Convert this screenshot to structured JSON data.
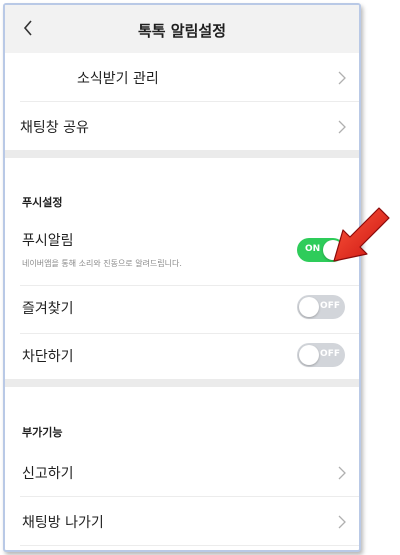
{
  "header": {
    "title": "톡톡 알림설정"
  },
  "rows_top": [
    {
      "label": "소식받기 관리"
    },
    {
      "label": "채팅창 공유"
    }
  ],
  "push_section": {
    "title": "푸시설정",
    "push_alarm": {
      "label": "푸시알림",
      "description": "네이버앱을 통해 소리와 진동으로 알려드립니다.",
      "toggle_text": "ON",
      "enabled": true
    },
    "favorites": {
      "label": "즐겨찾기",
      "toggle_text": "OFF",
      "enabled": false
    },
    "block": {
      "label": "차단하기",
      "toggle_text": "OFF",
      "enabled": false
    }
  },
  "extra_section": {
    "title": "부가기능",
    "items": [
      {
        "label": "신고하기"
      },
      {
        "label": "채팅방 나가기"
      }
    ]
  },
  "colors": {
    "toggle_on": "#2ecc5a",
    "toggle_off": "#d2d5da",
    "arrow": "#e8231d"
  },
  "icons": {
    "back": "chevron-left-icon",
    "row": "chevron-right-icon",
    "annotation": "red-arrow-icon"
  }
}
